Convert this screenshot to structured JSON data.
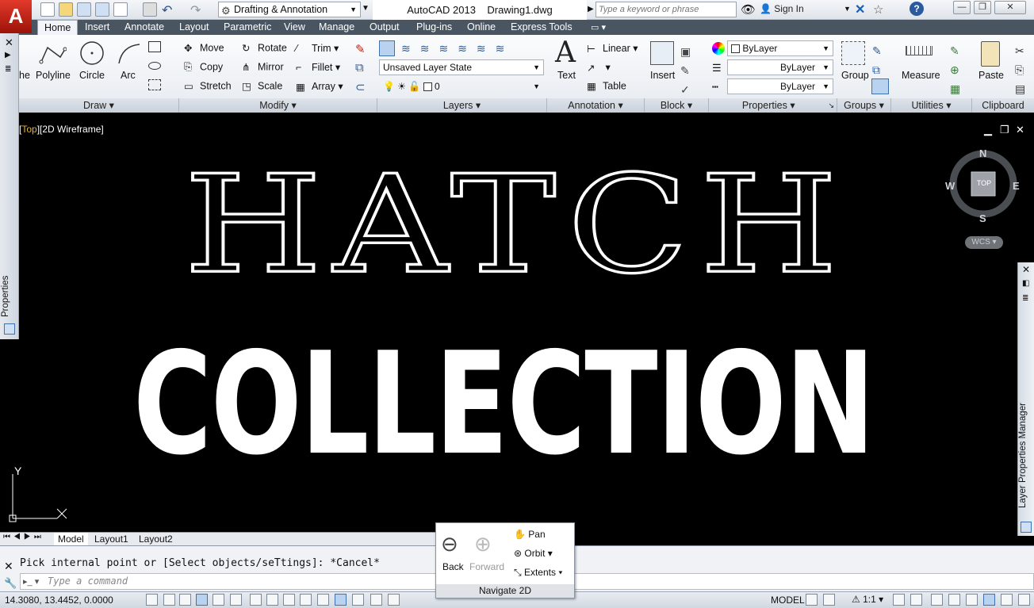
{
  "titlebar": {
    "workspace": "Drafting & Annotation",
    "app_name": "AutoCAD 2013",
    "document": "Drawing1.dwg",
    "search_placeholder": "Type a keyword or phrase",
    "sign_in": "Sign In"
  },
  "tabs": [
    "Home",
    "Insert",
    "Annotate",
    "Layout",
    "Parametric",
    "View",
    "Manage",
    "Output",
    "Plug-ins",
    "Online",
    "Express Tools"
  ],
  "ribbon": {
    "draw": {
      "title": "Draw",
      "items": [
        "Polyline",
        "Circle",
        "Arc"
      ],
      "clipped_label": "he"
    },
    "modify": {
      "title": "Modify",
      "items": [
        "Move",
        "Rotate",
        "Trim",
        "Copy",
        "Mirror",
        "Fillet",
        "Stretch",
        "Scale",
        "Array"
      ]
    },
    "layers": {
      "title": "Layers",
      "layer_state": "Unsaved Layer State",
      "current_layer": "0"
    },
    "annotation": {
      "title": "Annotation",
      "text": "Text",
      "linear": "Linear",
      "table": "Table"
    },
    "block": {
      "title": "Block",
      "insert": "Insert"
    },
    "properties": {
      "title": "Properties",
      "color": "ByLayer",
      "linetype": "ByLayer",
      "lineweight": "ByLayer"
    },
    "groups": {
      "title": "Groups",
      "group": "Group"
    },
    "utilities": {
      "title": "Utilities",
      "measure": "Measure"
    },
    "clipboard": {
      "title": "Clipboard",
      "paste": "Paste"
    }
  },
  "palettes": {
    "left": "Properties",
    "right": "Layer Properties Manager"
  },
  "viewport": {
    "view": "Top",
    "style": "2D Wireframe",
    "text_line1": "HATCH",
    "text_line2": "COLLECTION",
    "compass": {
      "n": "N",
      "s": "S",
      "e": "E",
      "w": "W",
      "cube": "TOP"
    },
    "wcs": "WCS",
    "ucs_y": "Y"
  },
  "layout_tabs": [
    "Model",
    "Layout1",
    "Layout2"
  ],
  "command": {
    "history": "Pick internal point or [Select objects/seTtings]: *Cancel*",
    "placeholder": "Type a command"
  },
  "status": {
    "coordinates": "14.3080, 13.4452, 0.0000",
    "space": "MODEL",
    "scale": "1:1"
  },
  "navigate": {
    "title": "Navigate 2D",
    "back": "Back",
    "forward": "Forward",
    "pan": "Pan",
    "orbit": "Orbit",
    "extents": "Extents"
  },
  "colors": {
    "accent": "#3d73b1",
    "app_red": "#c8261a",
    "viewport_bg": "#000000",
    "layout_tab_bar": "#4a5562"
  }
}
